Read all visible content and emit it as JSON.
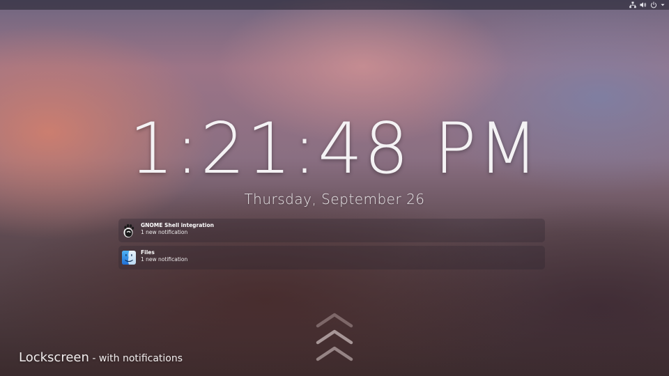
{
  "top_bar": {
    "status_icons": [
      "network-wired-icon",
      "volume-icon",
      "power-icon",
      "dropdown-arrow-icon"
    ]
  },
  "lockscreen": {
    "time": "1:21:48 PM",
    "date": "Thursday, September 26"
  },
  "notifications": [
    {
      "app": "GNOME Shell integration",
      "summary": "1 new notification",
      "icon": "gnome-foot-icon"
    },
    {
      "app": "Files",
      "summary": "1 new notification",
      "icon": "files-finder-icon"
    }
  ],
  "caption": {
    "main": "Lockscreen",
    "sub": " - with notifications"
  },
  "unlock": {
    "icon": "unlock-chevrons-icon"
  }
}
